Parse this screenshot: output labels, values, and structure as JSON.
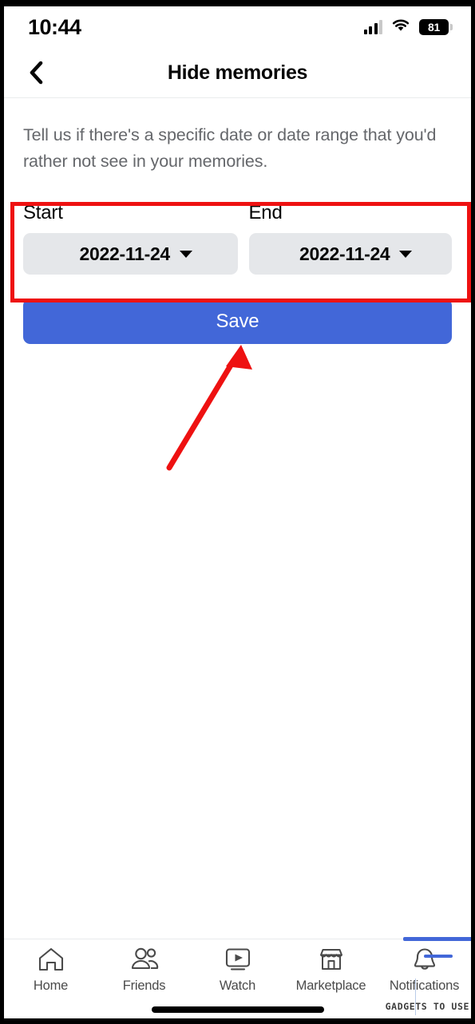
{
  "status_bar": {
    "time": "10:44",
    "battery_level": "81",
    "cellular_icon": "cellular-signal-icon",
    "wifi_icon": "wifi-icon",
    "battery_icon": "battery-icon"
  },
  "header": {
    "title": "Hide memories",
    "back_icon": "back-chevron-icon"
  },
  "main": {
    "description": "Tell us if there's a specific date or date range that you'd rather not see in your memories.",
    "start": {
      "label": "Start",
      "value": "2022-11-24",
      "caret_icon": "chevron-down-icon"
    },
    "end": {
      "label": "End",
      "value": "2022-11-24",
      "caret_icon": "chevron-down-icon"
    },
    "save_label": "Save"
  },
  "annotations": {
    "highlight_color": "#ee1111",
    "arrow_color": "#ee1111",
    "arrow_from": "207,578",
    "arrow_to": "297,428"
  },
  "bottom_nav": {
    "items": [
      {
        "label": "Home",
        "icon": "home-icon"
      },
      {
        "label": "Friends",
        "icon": "friends-icon"
      },
      {
        "label": "Watch",
        "icon": "watch-play-icon"
      },
      {
        "label": "Marketplace",
        "icon": "marketplace-storefront-icon"
      },
      {
        "label": "Notifications",
        "icon": "bell-icon"
      }
    ],
    "menu_partial": {
      "icon": "hamburger-menu-icon",
      "active_color": "#4267d8"
    }
  },
  "watermark": "GADGETS TO USE",
  "theme": {
    "accent_blue": "#4267d8",
    "pill_gray": "#e5e7ea",
    "muted_text": "#65676b"
  }
}
